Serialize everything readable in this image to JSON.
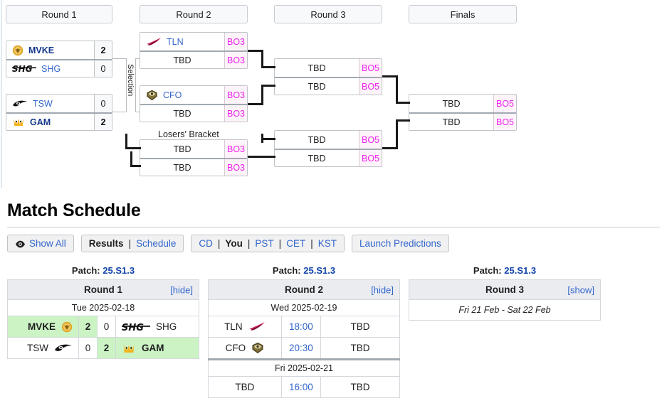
{
  "bracket": {
    "round_headers": [
      {
        "label": "Round 1"
      },
      {
        "label": "Round 2"
      },
      {
        "label": "Round 3"
      },
      {
        "label": "Finals"
      }
    ],
    "selection_label": "Selection",
    "losers_bracket_label": "Losers' Bracket",
    "matches": {
      "r1m1": {
        "top": {
          "team": "MVKE",
          "logo": "mvke-logo",
          "score": "2",
          "winner": true
        },
        "bottom": {
          "team": "SHG",
          "logo": "shg-logo",
          "score": "0",
          "winner": false
        }
      },
      "r1m2": {
        "top": {
          "team": "TSW",
          "logo": "tsw-logo",
          "score": "0",
          "winner": false
        },
        "bottom": {
          "team": "GAM",
          "logo": "gam-logo",
          "score": "2",
          "winner": true
        }
      },
      "r2m1": {
        "top": {
          "team": "TLN",
          "logo": "tln-logo",
          "bo": "BO3"
        },
        "bottom": {
          "team": "TBD",
          "logo": "none",
          "bo": "BO3"
        }
      },
      "r2m2": {
        "top": {
          "team": "CFO",
          "logo": "cfo-logo",
          "bo": "BO3"
        },
        "bottom": {
          "team": "TBD",
          "logo": "none",
          "bo": "BO3"
        }
      },
      "r2lb": {
        "top": {
          "team": "TBD",
          "logo": "none",
          "bo": "BO3"
        },
        "bottom": {
          "team": "TBD",
          "logo": "none",
          "bo": "BO3"
        }
      },
      "r3m1": {
        "top": {
          "team": "TBD",
          "logo": "none",
          "bo": "BO5"
        },
        "bottom": {
          "team": "TBD",
          "logo": "none",
          "bo": "BO5"
        }
      },
      "r3m2": {
        "top": {
          "team": "TBD",
          "logo": "none",
          "bo": "BO5"
        },
        "bottom": {
          "team": "TBD",
          "logo": "none",
          "bo": "BO5"
        }
      },
      "finals": {
        "top": {
          "team": "TBD",
          "logo": "none",
          "bo": "BO5"
        },
        "bottom": {
          "team": "TBD",
          "logo": "none",
          "bo": "BO5"
        }
      }
    }
  },
  "schedule": {
    "heading": "Match Schedule",
    "buttons": {
      "show_all": {
        "icon": "eye-icon",
        "label": "Show All"
      },
      "results": "Results",
      "schedule": "Schedule",
      "tz_cd": "CD",
      "tz_you": "You",
      "tz_pst": "PST",
      "tz_cet": "CET",
      "tz_kst": "KST",
      "launch_predictions": "Launch Predictions",
      "separator": "|"
    },
    "tables": [
      {
        "patch_label": "Patch:",
        "patch_value": "25.S1.3",
        "round_label": "Round 1",
        "toggle": "[hide]",
        "groups": [
          {
            "date": "Tue 2025-02-18",
            "matches": [
              {
                "left_team": "MVKE",
                "left_logo": "mvke-logo",
                "left_score": "2",
                "right_team": "SHG",
                "right_logo": "shg-logo",
                "right_score": "0",
                "left_win": true,
                "right_win": false
              },
              {
                "left_team": "TSW",
                "left_logo": "tsw-logo",
                "left_score": "0",
                "right_team": "GAM",
                "right_logo": "gam-logo",
                "right_score": "2",
                "left_win": false,
                "right_win": true
              }
            ]
          }
        ]
      },
      {
        "patch_label": "Patch:",
        "patch_value": "25.S1.3",
        "round_label": "Round 2",
        "toggle": "[hide]",
        "groups": [
          {
            "date": "Wed 2025-02-19",
            "matches": [
              {
                "left_team": "TLN",
                "left_logo": "tln-logo",
                "time": "18:00",
                "right_team": "TBD"
              },
              {
                "left_team": "CFO",
                "left_logo": "cfo-logo",
                "time": "20:30",
                "right_team": "TBD"
              }
            ]
          },
          {
            "date": "Fri 2025-02-21",
            "matches": [
              {
                "left_team": "TBD",
                "left_logo": "none",
                "time": "16:00",
                "right_team": "TBD"
              }
            ]
          }
        ]
      },
      {
        "patch_label": "Patch:",
        "patch_value": "25.S1.3",
        "round_label": "Round 3",
        "toggle": "[show]",
        "collapsed_text": "Fri 21 Feb - Sat 22 Feb"
      }
    ]
  },
  "colors": {
    "link": "#3366cc",
    "bo_badge": "#ee22ee",
    "bo_badge_bg": "#fdf4fa",
    "winner_bg": "#ccf3c4",
    "header_bg": "#eaecf0",
    "border": "#c0c4c8"
  }
}
